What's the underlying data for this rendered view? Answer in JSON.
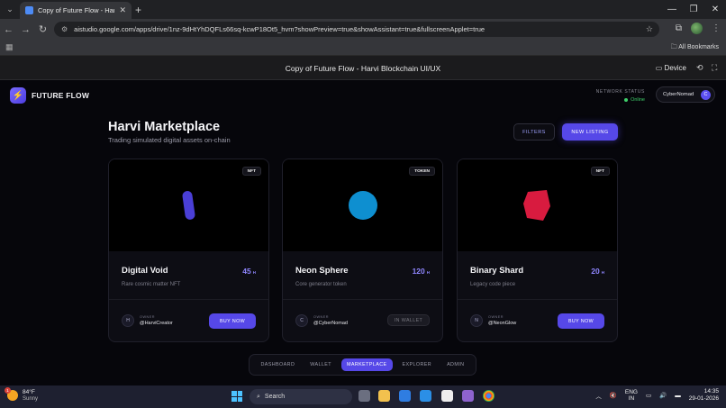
{
  "browser": {
    "tab_title": "Copy of Future Flow - Harvi B...",
    "url": "aistudio.google.com/apps/drive/1nz-9dHtYhDQFLs66sq-kcwP18Ot5_hvm?showPreview=true&showAssistant=true&fullscreenApplet=true",
    "all_bookmarks": "All Bookmarks"
  },
  "app_title": {
    "title": "Copy of Future Flow - Harvi Blockchain UI/UX",
    "device_label": "Device"
  },
  "header": {
    "brand": "FUTURE FLOW",
    "network_status_label": "NETWORK STATUS",
    "network_status_value": "Online",
    "user_name": "CyberNomad",
    "user_initial": "C"
  },
  "page": {
    "title": "Harvi Marketplace",
    "subtitle": "Trading simulated digital assets on-chain",
    "filters_label": "FILTERS",
    "new_listing_label": "NEW LISTING"
  },
  "cards": [
    {
      "badge": "NFT",
      "name": "Digital Void",
      "price": "45",
      "currency": "H",
      "description": "Rare cosmic matter NFT",
      "owner_label": "OWNER",
      "owner_initial": "H",
      "owner": "@HarviCreator",
      "action": "BUY NOW",
      "art_color": "#4a3fd6"
    },
    {
      "badge": "TOKEN",
      "name": "Neon Sphere",
      "price": "120",
      "currency": "H",
      "description": "Core generator token",
      "owner_label": "OWNER",
      "owner_initial": "C",
      "owner": "@CyberNomad",
      "action": "IN WALLET",
      "art_color": "#0e8fd0"
    },
    {
      "badge": "NFT",
      "name": "Binary Shard",
      "price": "20",
      "currency": "H",
      "description": "Legacy code piece",
      "owner_label": "OWNER",
      "owner_initial": "N",
      "owner": "@NeonGlow",
      "action": "BUY NOW",
      "art_color": "#d81b3f"
    }
  ],
  "nav": {
    "items": [
      "DASHBOARD",
      "WALLET",
      "MARKETPLACE",
      "EXPLORER",
      "ADMIN"
    ],
    "active": "MARKETPLACE"
  },
  "taskbar": {
    "temperature": "84°F",
    "condition": "Sunny",
    "weather_badge": "1",
    "search_placeholder": "Search",
    "lang_top": "ENG",
    "lang_bottom": "IN",
    "time": "14:35",
    "date": "29-01-2026"
  },
  "colors": {
    "accent": "#5648e8",
    "online": "#3ecf6a"
  }
}
